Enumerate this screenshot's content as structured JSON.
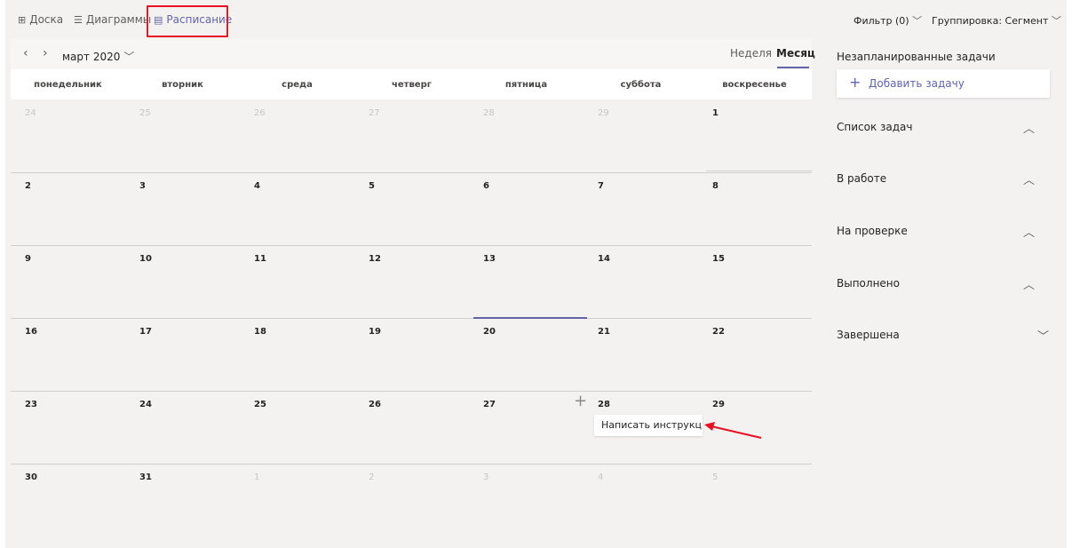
{
  "tabs": [
    {
      "label": "Доска",
      "icon": "board-icon"
    },
    {
      "label": "Диаграммы",
      "icon": "charts-icon"
    },
    {
      "label": "Расписание",
      "icon": "schedule-icon"
    }
  ],
  "filter_label": "Фильтр (0)",
  "grouping_label": "Группировка: Сегмент",
  "calendar": {
    "month_label": "март 2020",
    "week_label": "Неделя",
    "month_view_label": "Месяц",
    "weekdays": [
      "понедельник",
      "вторник",
      "среда",
      "четверг",
      "пятница",
      "суббота",
      "воскресенье"
    ],
    "weeks": [
      [
        "24",
        "25",
        "26",
        "27",
        "28",
        "29",
        "1"
      ],
      [
        "2",
        "3",
        "4",
        "5",
        "6",
        "7",
        "8"
      ],
      [
        "9",
        "10",
        "11",
        "12",
        "13",
        "14",
        "15"
      ],
      [
        "16",
        "17",
        "18",
        "19",
        "20",
        "21",
        "22"
      ],
      [
        "23",
        "24",
        "25",
        "26",
        "27",
        "28",
        "29"
      ],
      [
        "30",
        "31",
        "1",
        "2",
        "3",
        "4",
        "5"
      ]
    ],
    "muted": [
      [
        true,
        true,
        true,
        true,
        true,
        true,
        false
      ],
      [
        false,
        false,
        false,
        false,
        false,
        false,
        false
      ],
      [
        false,
        false,
        false,
        false,
        false,
        false,
        false
      ],
      [
        false,
        false,
        false,
        false,
        false,
        false,
        false
      ],
      [
        false,
        false,
        false,
        false,
        false,
        false,
        false
      ],
      [
        false,
        false,
        true,
        true,
        true,
        true,
        true
      ]
    ],
    "task_card_text": "Написать инструкц..."
  },
  "panel": {
    "title": "Незапланированные задачи",
    "add_task_label": "Добавить задачу",
    "buckets": [
      {
        "label": "Список задач",
        "state": "expanded"
      },
      {
        "label": "В работе",
        "state": "expanded"
      },
      {
        "label": "На проверке",
        "state": "expanded"
      },
      {
        "label": "Выполнено",
        "state": "expanded"
      },
      {
        "label": "Завершена",
        "state": "collapsed"
      }
    ]
  },
  "colors": {
    "accent": "#6264a7",
    "highlight": "#e81123"
  }
}
